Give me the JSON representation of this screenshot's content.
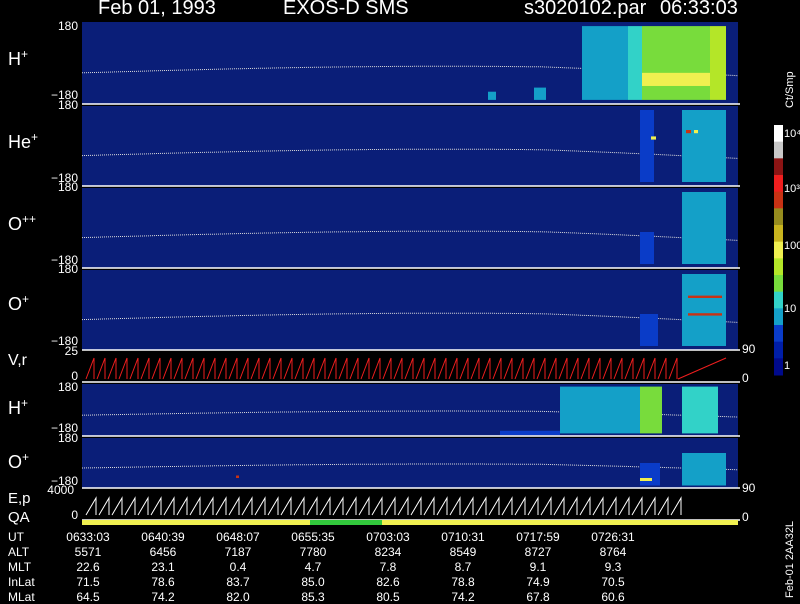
{
  "header": {
    "date": "Feb 01, 1993",
    "instrument": "EXOS-D SMS",
    "file": "s3020102.par",
    "time": "06:33:03"
  },
  "colorbar": {
    "unit": "Ct/Smp",
    "tick_labels": [
      "1",
      "10",
      "100",
      "10³",
      "10⁴"
    ],
    "colors": [
      "#000a8c",
      "#001ea8",
      "#0a3cc8",
      "#14a0c8",
      "#32d2c8",
      "#78dc3c",
      "#b4e628",
      "#f0f050",
      "#c8b41e",
      "#968c1e",
      "#c83214",
      "#f01e1e",
      "#8c1414",
      "#c8c8c8",
      "#ffffff"
    ]
  },
  "panels": [
    {
      "id": "h1",
      "label_main": "H",
      "label_sup": "+",
      "top_tick": "180",
      "bottom_tick": "−180"
    },
    {
      "id": "he",
      "label_main": "He",
      "label_sup": "+",
      "top_tick": "180",
      "bottom_tick": "−180"
    },
    {
      "id": "opp",
      "label_main": "O",
      "label_sup": "++",
      "top_tick": "180",
      "bottom_tick": "−180"
    },
    {
      "id": "o1",
      "label_main": "O",
      "label_sup": "+",
      "top_tick": "180",
      "bottom_tick": "−180"
    },
    {
      "id": "vr",
      "label_main": "V,r",
      "label_sup": "",
      "top_tick": "25",
      "bottom_tick": "0",
      "right_top": "90",
      "right_bottom": "0"
    },
    {
      "id": "h2",
      "label_main": "H",
      "label_sup": "+",
      "top_tick": "180",
      "bottom_tick": "−180"
    },
    {
      "id": "o2",
      "label_main": "O",
      "label_sup": "+",
      "top_tick": "180",
      "bottom_tick": "−180"
    },
    {
      "id": "ep",
      "label_main": "E,p",
      "label_sub": "QA",
      "top_tick": "4000",
      "bottom_tick": "0",
      "right_top": "90",
      "right_bottom": "0"
    }
  ],
  "footer": {
    "row_labels": [
      "UT",
      "ALT",
      "MLT",
      "InLat",
      "MLat"
    ],
    "columns": [
      {
        "UT": "0633:03",
        "ALT": "5571",
        "MLT": "22.6",
        "InLat": "71.5",
        "MLat": "64.5"
      },
      {
        "UT": "0640:39",
        "ALT": "6456",
        "MLT": "23.1",
        "InLat": "78.6",
        "MLat": "74.2"
      },
      {
        "UT": "0648:07",
        "ALT": "7187",
        "MLT": "0.4",
        "InLat": "83.7",
        "MLat": "82.0"
      },
      {
        "UT": "0655:35",
        "ALT": "7780",
        "MLT": "4.7",
        "InLat": "85.0",
        "MLat": "85.3"
      },
      {
        "UT": "0703:03",
        "ALT": "8234",
        "MLT": "7.8",
        "InLat": "82.6",
        "MLat": "80.5"
      },
      {
        "UT": "0710:31",
        "ALT": "8549",
        "MLT": "8.7",
        "InLat": "78.8",
        "MLat": "74.2"
      },
      {
        "UT": "0717:59",
        "ALT": "8727",
        "MLT": "9.1",
        "InLat": "74.9",
        "MLat": "67.8"
      },
      {
        "UT": "0726:31",
        "ALT": "8764",
        "MLT": "9.3",
        "InLat": "70.5",
        "MLat": "60.6"
      }
    ],
    "side_text": "Feb-01 2AA32L"
  },
  "chart_data": {
    "type": "heatmap",
    "title": "Feb 01, 1993   EXOS-D SMS",
    "x_ticks": [
      "0633:03",
      "0640:39",
      "0648:07",
      "0655:35",
      "0703:03",
      "0710:31",
      "0717:59",
      "0726:31"
    ],
    "series": [
      {
        "name": "H+",
        "ylim": [
          -180,
          180
        ]
      },
      {
        "name": "He+",
        "ylim": [
          -180,
          180
        ]
      },
      {
        "name": "O++",
        "ylim": [
          -180,
          180
        ]
      },
      {
        "name": "O+",
        "ylim": [
          -180,
          180
        ]
      },
      {
        "name": "V,r",
        "ylim": [
          0,
          25
        ]
      },
      {
        "name": "H+",
        "ylim": [
          -180,
          180
        ]
      },
      {
        "name": "O+",
        "ylim": [
          -180,
          180
        ]
      },
      {
        "name": "E,p",
        "ylim": [
          0,
          4000
        ]
      }
    ]
  }
}
